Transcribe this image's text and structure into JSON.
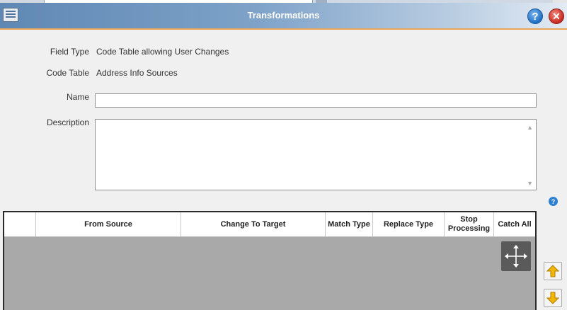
{
  "window": {
    "title": "Transformations"
  },
  "titlebar": {
    "help_symbol": "?",
    "close_symbol": "✕"
  },
  "form": {
    "field_type": {
      "label": "Field Type",
      "value": "Code Table allowing User Changes"
    },
    "code_table": {
      "label": "Code Table",
      "value": "Address Info Sources"
    },
    "name": {
      "label": "Name",
      "value": ""
    },
    "description": {
      "label": "Description",
      "value": ""
    }
  },
  "grid": {
    "columns": [
      {
        "label": ""
      },
      {
        "label": "From Source"
      },
      {
        "label": "Change To Target"
      },
      {
        "label": "Match Type"
      },
      {
        "label": "Replace Type"
      },
      {
        "label": "Stop Processing"
      },
      {
        "label": "Catch All"
      }
    ],
    "rows": []
  },
  "icons": {
    "app": "grid-window-icon",
    "help": "help-icon",
    "close": "close-icon",
    "small_help": "info-help-icon",
    "move": "move-arrows-icon",
    "up": "arrow-up-icon",
    "down": "arrow-down-icon"
  },
  "colors": {
    "titlebar_start": "#5f88b4",
    "accent_strip": "#e7a55c",
    "grid_body": "#a9a9a9",
    "arrow_yellow": "#f2b705"
  }
}
